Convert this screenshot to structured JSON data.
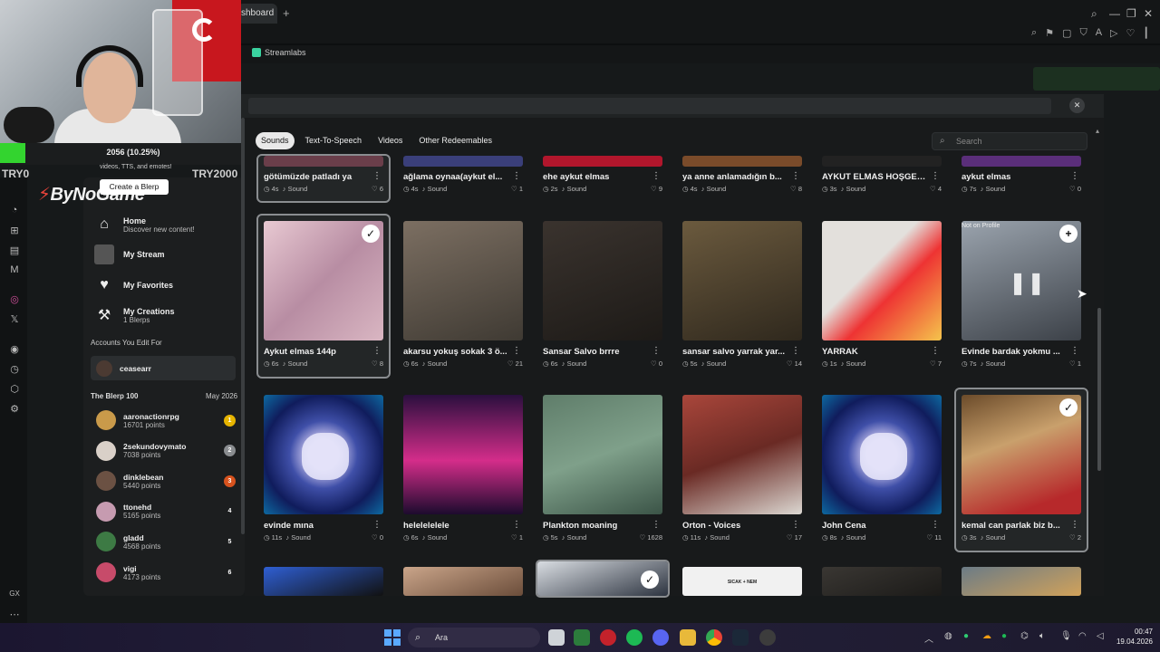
{
  "browser": {
    "tab_label": "shboard",
    "bookmark": "Streamlabs",
    "icons": [
      "search-icon",
      "minimize-icon",
      "restore-icon",
      "close-icon"
    ]
  },
  "donation": {
    "progress_text": "2056 (10.25%)",
    "progress": 0.1025,
    "start": "TRY0",
    "goal": "TRY2000",
    "subtext": "videos, TTS, and emotes!"
  },
  "sidebar": {
    "logo": "ByNoGame",
    "create_label": "Create a Blerp",
    "nav": [
      {
        "title": "Home",
        "sub": "Discover new content!"
      },
      {
        "title": "My Stream",
        "sub": ""
      },
      {
        "title": "My Favorites",
        "sub": ""
      },
      {
        "title": "My Creations",
        "sub": "1 Blerps"
      }
    ],
    "accounts_heading": "Accounts You Edit For",
    "account_name": "ceasearr",
    "board_title": "The Blerp 100",
    "board_date": "May 2026",
    "leaderboard": [
      {
        "name": "aaronactionrpg",
        "points": "16701 points",
        "rank": "1",
        "color": "#e6b400",
        "avatar": "#c99a4a"
      },
      {
        "name": "2sekundovymato",
        "points": "7038 points",
        "rank": "2",
        "color": "#8a8d90",
        "avatar": "#d9d0c8"
      },
      {
        "name": "dinklebean",
        "points": "5440 points",
        "rank": "3",
        "color": "#d7531e",
        "avatar": "#6b5143"
      },
      {
        "name": "ttonehd",
        "points": "5165 points",
        "rank": "4",
        "color": "",
        "avatar": "#c69bb0"
      },
      {
        "name": "gladd",
        "points": "4568 points",
        "rank": "5",
        "color": "",
        "avatar": "#3d7a44"
      },
      {
        "name": "vigi",
        "points": "4173 points",
        "rank": "6",
        "color": "",
        "avatar": "#c74b6a"
      }
    ]
  },
  "modal": {
    "tabs": [
      "Sounds",
      "Text-To-Speech",
      "Videos",
      "Other Redeemables"
    ],
    "active_tab": "Sounds",
    "search_placeholder": "Search",
    "sound_label": "Sound",
    "rows": [
      [
        {
          "title": "götümüzde patladı ya",
          "dur": "4s",
          "hearts": "6",
          "selected": true
        },
        {
          "title": "ağlama oynaa(aykut el...",
          "dur": "4s",
          "hearts": "1"
        },
        {
          "title": "ehe aykut elmas",
          "dur": "2s",
          "hearts": "9"
        },
        {
          "title": "ya anne anlamadığın b...",
          "dur": "4s",
          "hearts": "8"
        },
        {
          "title": "AYKUT ELMAS HOŞGEL...",
          "dur": "3s",
          "hearts": "4"
        },
        {
          "title": "aykut elmas",
          "dur": "7s",
          "hearts": "0"
        }
      ],
      [
        {
          "title": "Aykut elmas 144p",
          "dur": "6s",
          "hearts": "8",
          "selected": true,
          "check": true
        },
        {
          "title": "akarsu yokuş sokak 3 ö...",
          "dur": "6s",
          "hearts": "21"
        },
        {
          "title": "Sansar Salvo brrre",
          "dur": "6s",
          "hearts": "0"
        },
        {
          "title": "sansar salvo yarrak yar...",
          "dur": "5s",
          "hearts": "14"
        },
        {
          "title": "YARRAK",
          "dur": "1s",
          "hearts": "7"
        },
        {
          "title": "Evinde bardak yokmu ...",
          "dur": "7s",
          "hearts": "1",
          "badge": "Not on Profile",
          "plus": true
        }
      ],
      [
        {
          "title": "evinde mına",
          "dur": "11s",
          "hearts": "0"
        },
        {
          "title": "helelelelele",
          "dur": "6s",
          "hearts": "1"
        },
        {
          "title": "Plankton moaning",
          "dur": "5s",
          "hearts": "1628"
        },
        {
          "title": "Orton - Voices",
          "dur": "11s",
          "hearts": "17"
        },
        {
          "title": "John Cena",
          "dur": "8s",
          "hearts": "11"
        },
        {
          "title": "kemal can parlak biz b...",
          "dur": "3s",
          "hearts": "2",
          "selected": true,
          "check": true
        }
      ]
    ],
    "row4_tile_text": "SICAK + NEM"
  },
  "taskbar": {
    "search_label": "Ara",
    "time": "00:47",
    "date": "19.04.2026",
    "gx_label": "GX"
  }
}
